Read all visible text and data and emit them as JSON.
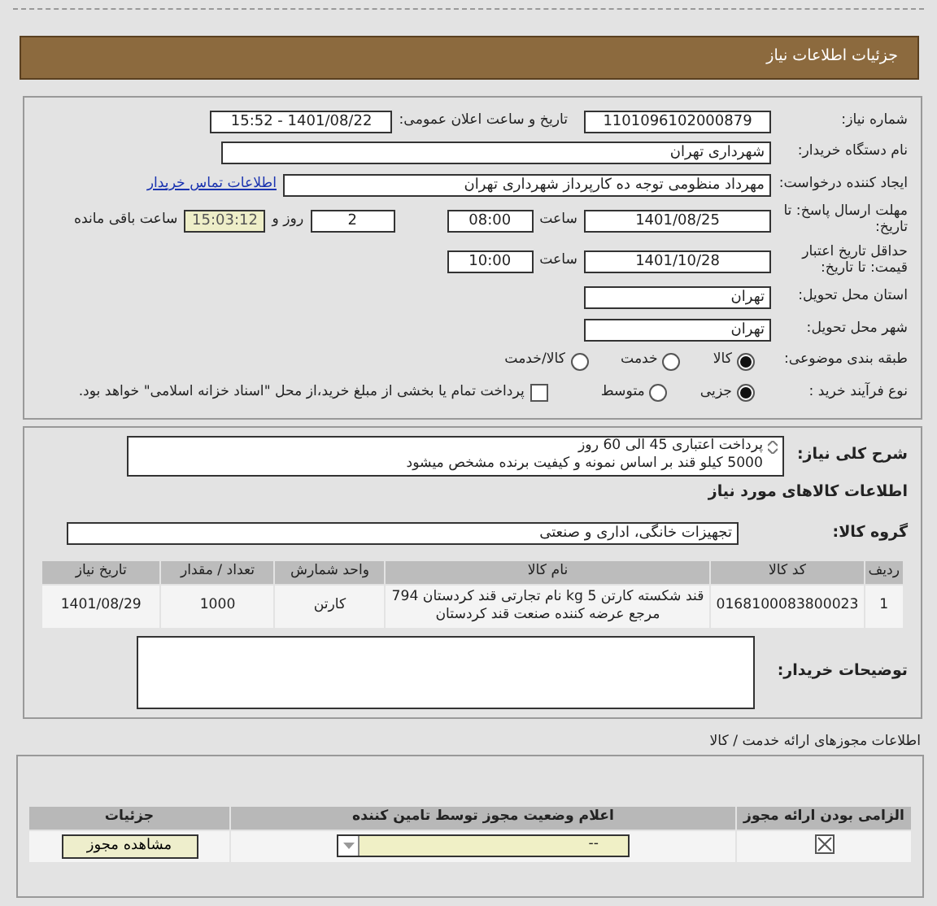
{
  "header": {
    "title": "جزئیات اطلاعات نیاز"
  },
  "need_number": {
    "label": "شماره نیاز:",
    "value": "1101096102000879"
  },
  "announce": {
    "label": "تاریخ و ساعت اعلان عمومی:",
    "value": "1401/08/22 - 15:52"
  },
  "buyer": {
    "label": "نام دستگاه خریدار:",
    "value": "شهرداری تهران"
  },
  "requester": {
    "label": "ایجاد کننده درخواست:",
    "value": "مهرداد منظومی توجه ده کارپرداز شهرداری تهران",
    "link": "اطلاعات تماس خریدار"
  },
  "deadline": {
    "label": "مهلت ارسال پاسخ: تا تاریخ:",
    "date": "1401/08/25",
    "time_label": "ساعت",
    "time": "08:00",
    "days": "2",
    "days_label": "روز و",
    "remaining": "15:03:12",
    "remaining_label": "ساعت باقی مانده"
  },
  "validity": {
    "label": "حداقل تاریخ اعتبار قیمت: تا تاریخ:",
    "date": "1401/10/28",
    "time_label": "ساعت",
    "time": "10:00"
  },
  "province": {
    "label": "استان محل تحویل:",
    "value": "تهران"
  },
  "city": {
    "label": "شهر محل تحویل:",
    "value": "تهران"
  },
  "category": {
    "label": "طبقه بندی موضوعی:",
    "options": [
      {
        "label": "کالا",
        "selected": true
      },
      {
        "label": "خدمت",
        "selected": false
      },
      {
        "label": "کالا/خدمت",
        "selected": false
      }
    ]
  },
  "process": {
    "label": "نوع فرآیند خرید :",
    "options": [
      {
        "label": "جزیی",
        "selected": true
      },
      {
        "label": "متوسط",
        "selected": false
      }
    ],
    "treasury": {
      "label": "پرداخت تمام یا بخشی از مبلغ خرید،از محل \"اسناد خزانه اسلامی\" خواهد بود.",
      "checked": false
    }
  },
  "description": {
    "label": "شرح کلی نیاز:",
    "lines": [
      "پرداخت اعتباری 45 الی 60 روز",
      "5000 کیلو قند بر اساس نمونه و کیفیت برنده مشخص میشود"
    ]
  },
  "goods_heading": "اطلاعات کالاهای مورد نیاز",
  "group": {
    "label": "گروه کالا:",
    "value": "تجهیزات خانگی، اداری و صنعتی"
  },
  "items": {
    "columns": [
      "ردیف",
      "کد کالا",
      "نام کالا",
      "واحد شمارش",
      "تعداد / مقدار",
      "تاریخ نیاز"
    ],
    "rows": [
      [
        "1",
        "0168100083800023",
        "قند شکسته کارتن 5 kg نام تجارتی قند کردستان 794 مرجع عرضه کننده صنعت قند کردستان",
        "کارتن",
        "1000",
        "1401/08/29"
      ]
    ]
  },
  "notes": {
    "label": "توضیحات خریدار:"
  },
  "permits": {
    "title": "اطلاعات مجوزهای ارائه خدمت / کالا",
    "columns": [
      "الزامی بودن ارائه مجوز",
      "اعلام وضعیت مجوز توسط تامین کننده",
      "جزئیات"
    ],
    "rows": [
      {
        "required": true,
        "status": "--",
        "button": "مشاهده مجوز"
      }
    ]
  }
}
